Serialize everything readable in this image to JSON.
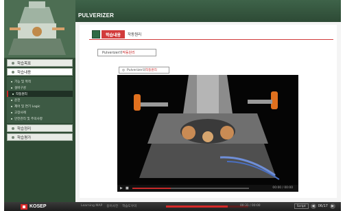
{
  "app": {
    "title": "PULVERIZER"
  },
  "nav": {
    "items": [
      {
        "label": "학습목표"
      },
      {
        "label": "학습내용"
      },
      {
        "label": "학습정리"
      },
      {
        "label": "학습평가"
      }
    ],
    "sub_items": [
      {
        "label": "기능 및 목적"
      },
      {
        "label": "설비구성"
      },
      {
        "label": "작동원리"
      },
      {
        "label": "운전"
      },
      {
        "label": "제어 및 연기 Logic"
      },
      {
        "label": "고장사례"
      },
      {
        "label": "안전관리 및 주의사항"
      }
    ]
  },
  "section": {
    "title": "학습내용",
    "subtitle": "작동원리"
  },
  "topic_label": {
    "prefix": "Pulverizer의 ",
    "highlight": "작동원리"
  },
  "video": {
    "tag_prefix": "Pulverizer의 ",
    "tag_highlight": "작동원리",
    "progress": 0.33,
    "time": "00:00 / 00:00"
  },
  "footer": {
    "logo": "KOSEP",
    "links": [
      "Learning MAP",
      "용어사전",
      "학습도우미"
    ],
    "progress": 0.75,
    "time": "00:31 / 00:00",
    "script_label": "Script",
    "page": "06/17"
  },
  "colors": {
    "accent": "#d23b3b",
    "nav_green": "#2f4a34",
    "header_green": "#3e6349"
  }
}
